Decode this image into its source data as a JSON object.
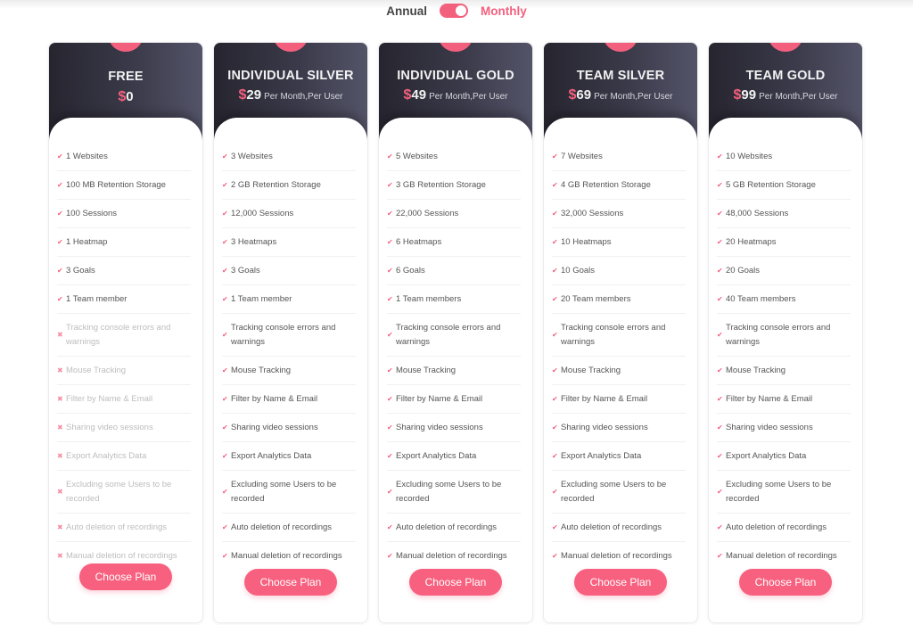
{
  "billing_toggle": {
    "annual_label": "Annual",
    "monthly_label": "Monthly",
    "selected": "Monthly"
  },
  "colors": {
    "accent": "#f3607d",
    "header_dark": "#26252f",
    "header_light": "#545469"
  },
  "choose_label": "Choose Plan",
  "plans": [
    {
      "name": "FREE",
      "currency": "$",
      "price": "0",
      "period": "",
      "features": [
        {
          "text": "1 Websites",
          "included": true
        },
        {
          "text": "100 MB Retention Storage",
          "included": true
        },
        {
          "text": "100 Sessions",
          "included": true
        },
        {
          "text": "1 Heatmap",
          "included": true
        },
        {
          "text": "3 Goals",
          "included": true
        },
        {
          "text": "1 Team member",
          "included": true
        },
        {
          "text": "Tracking console errors and warnings",
          "included": false
        },
        {
          "text": "Mouse Tracking",
          "included": false
        },
        {
          "text": "Filter by Name & Email",
          "included": false
        },
        {
          "text": "Sharing video sessions",
          "included": false
        },
        {
          "text": "Export Analytics Data",
          "included": false
        },
        {
          "text": "Excluding some Users to be recorded",
          "included": false
        },
        {
          "text": "Auto deletion of recordings",
          "included": false
        },
        {
          "text": "Manual deletion of recordings",
          "included": false
        }
      ]
    },
    {
      "name": "INDIVIDUAL SILVER",
      "currency": "$",
      "price": "29",
      "period": "Per Month,Per User",
      "features": [
        {
          "text": "3 Websites",
          "included": true
        },
        {
          "text": "2 GB Retention Storage",
          "included": true
        },
        {
          "text": "12,000 Sessions",
          "included": true
        },
        {
          "text": "3 Heatmaps",
          "included": true
        },
        {
          "text": "3 Goals",
          "included": true
        },
        {
          "text": "1 Team member",
          "included": true
        },
        {
          "text": "Tracking console errors and warnings",
          "included": true
        },
        {
          "text": "Mouse Tracking",
          "included": true
        },
        {
          "text": "Filter by Name & Email",
          "included": true
        },
        {
          "text": "Sharing video sessions",
          "included": true
        },
        {
          "text": "Export Analytics Data",
          "included": true
        },
        {
          "text": "Excluding some Users to be recorded",
          "included": true
        },
        {
          "text": "Auto deletion of recordings",
          "included": true
        },
        {
          "text": "Manual deletion of recordings",
          "included": true
        }
      ]
    },
    {
      "name": "INDIVIDUAL GOLD",
      "currency": "$",
      "price": "49",
      "period": "Per Month,Per User",
      "features": [
        {
          "text": "5 Websites",
          "included": true
        },
        {
          "text": "3 GB Retention Storage",
          "included": true
        },
        {
          "text": "22,000 Sessions",
          "included": true
        },
        {
          "text": "6 Heatmaps",
          "included": true
        },
        {
          "text": "6 Goals",
          "included": true
        },
        {
          "text": "1 Team members",
          "included": true
        },
        {
          "text": "Tracking console errors and warnings",
          "included": true
        },
        {
          "text": "Mouse Tracking",
          "included": true
        },
        {
          "text": "Filter by Name & Email",
          "included": true
        },
        {
          "text": "Sharing video sessions",
          "included": true
        },
        {
          "text": "Export Analytics Data",
          "included": true
        },
        {
          "text": "Excluding some Users to be recorded",
          "included": true
        },
        {
          "text": "Auto deletion of recordings",
          "included": true
        },
        {
          "text": "Manual deletion of recordings",
          "included": true
        }
      ]
    },
    {
      "name": "TEAM SILVER",
      "currency": "$",
      "price": "69",
      "period": "Per Month,Per User",
      "features": [
        {
          "text": "7 Websites",
          "included": true
        },
        {
          "text": "4 GB Retention Storage",
          "included": true
        },
        {
          "text": "32,000 Sessions",
          "included": true
        },
        {
          "text": "10 Heatmaps",
          "included": true
        },
        {
          "text": "10 Goals",
          "included": true
        },
        {
          "text": "20 Team members",
          "included": true
        },
        {
          "text": "Tracking console errors and warnings",
          "included": true
        },
        {
          "text": "Mouse Tracking",
          "included": true
        },
        {
          "text": "Filter by Name & Email",
          "included": true
        },
        {
          "text": "Sharing video sessions",
          "included": true
        },
        {
          "text": "Export Analytics Data",
          "included": true
        },
        {
          "text": "Excluding some Users to be recorded",
          "included": true
        },
        {
          "text": "Auto deletion of recordings",
          "included": true
        },
        {
          "text": "Manual deletion of recordings",
          "included": true
        }
      ]
    },
    {
      "name": "TEAM GOLD",
      "currency": "$",
      "price": "99",
      "period": "Per Month,Per User",
      "features": [
        {
          "text": "10 Websites",
          "included": true
        },
        {
          "text": "5 GB Retention Storage",
          "included": true
        },
        {
          "text": "48,000 Sessions",
          "included": true
        },
        {
          "text": "20 Heatmaps",
          "included": true
        },
        {
          "text": "20 Goals",
          "included": true
        },
        {
          "text": "40 Team members",
          "included": true
        },
        {
          "text": "Tracking console errors and warnings",
          "included": true
        },
        {
          "text": "Mouse Tracking",
          "included": true
        },
        {
          "text": "Filter by Name & Email",
          "included": true
        },
        {
          "text": "Sharing video sessions",
          "included": true
        },
        {
          "text": "Export Analytics Data",
          "included": true
        },
        {
          "text": "Excluding some Users to be recorded",
          "included": true
        },
        {
          "text": "Auto deletion of recordings",
          "included": true
        },
        {
          "text": "Manual deletion of recordings",
          "included": true
        }
      ]
    }
  ]
}
